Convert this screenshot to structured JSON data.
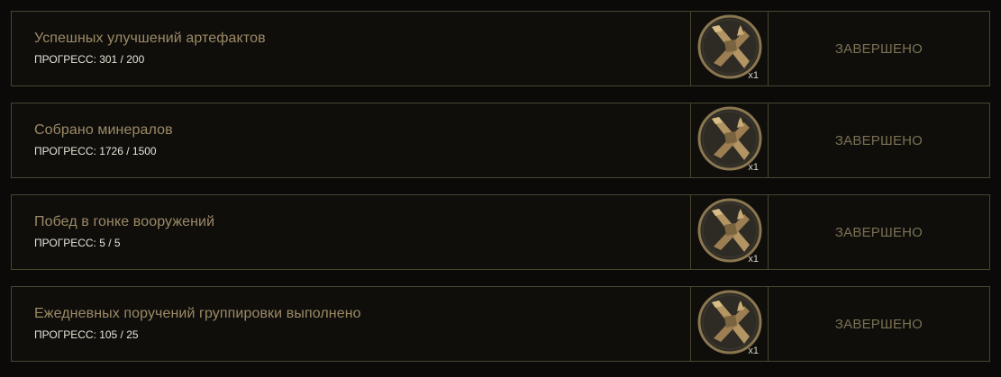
{
  "achievements": [
    {
      "title": "Успешных улучшений артефактов",
      "progress": "ПРОГРЕСС: 301 / 200",
      "reward_icon": "crossed-tools-coin-icon",
      "reward_qty": "x1",
      "status": "ЗАВЕРШЕНО"
    },
    {
      "title": "Собрано минералов",
      "progress": "ПРОГРЕСС: 1726 / 1500",
      "reward_icon": "crossed-tools-coin-icon",
      "reward_qty": "x1",
      "status": "ЗАВЕРШЕНО"
    },
    {
      "title": "Побед в гонке вооружений",
      "progress": "ПРОГРЕСС: 5 / 5",
      "reward_icon": "crossed-tools-coin-icon",
      "reward_qty": "x1",
      "status": "ЗАВЕРШЕНО"
    },
    {
      "title": "Ежедневных поручений группировки выполнено",
      "progress": "ПРОГРЕСС: 105 / 25",
      "reward_icon": "crossed-tools-coin-icon",
      "reward_qty": "x1",
      "status": "ЗАВЕРШЕНО"
    }
  ],
  "colors": {
    "border": "#4a4630",
    "title": "#9c8a66",
    "status": "#7a7152",
    "coin_rim": "#8a7650"
  }
}
